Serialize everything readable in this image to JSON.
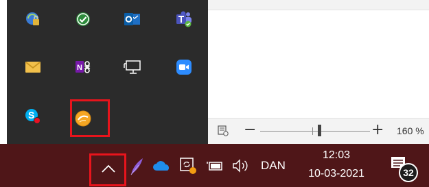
{
  "document": {
    "zoom_minus": "−",
    "zoom_plus": "+",
    "zoom_level": "160 %"
  },
  "tray_flyout": {
    "icons": [
      "network-lock-icon",
      "green-check-icon",
      "outlook-icon",
      "teams-icon",
      "mail-envelope-icon",
      "onenote-clipper-icon",
      "display-monitor-icon",
      "zoom-video-icon",
      "skype-icon",
      "orange-app-icon"
    ]
  },
  "taskbar": {
    "chevron": "^",
    "language": "DAN",
    "time": "12:03",
    "date": "10-03-2021",
    "notification_count": "32"
  },
  "colors": {
    "taskbar_bg": "#4f1618",
    "flyout_bg": "#2b2b2b",
    "highlight_red": "#e8141c"
  }
}
